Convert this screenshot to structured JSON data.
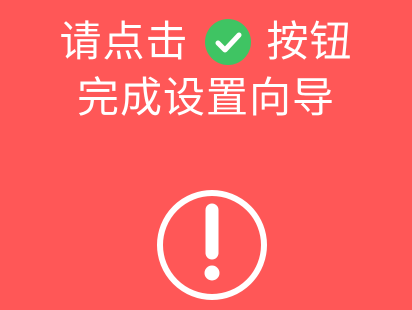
{
  "instruction": {
    "prefix": "请点击",
    "suffix": "按钮",
    "line2": "完成设置向导"
  },
  "icons": {
    "confirm": "check-circle-icon",
    "warning": "exclamation-circle-icon"
  },
  "colors": {
    "background": "#ff5757",
    "check_green": "#3fc463",
    "text": "#ffffff"
  }
}
